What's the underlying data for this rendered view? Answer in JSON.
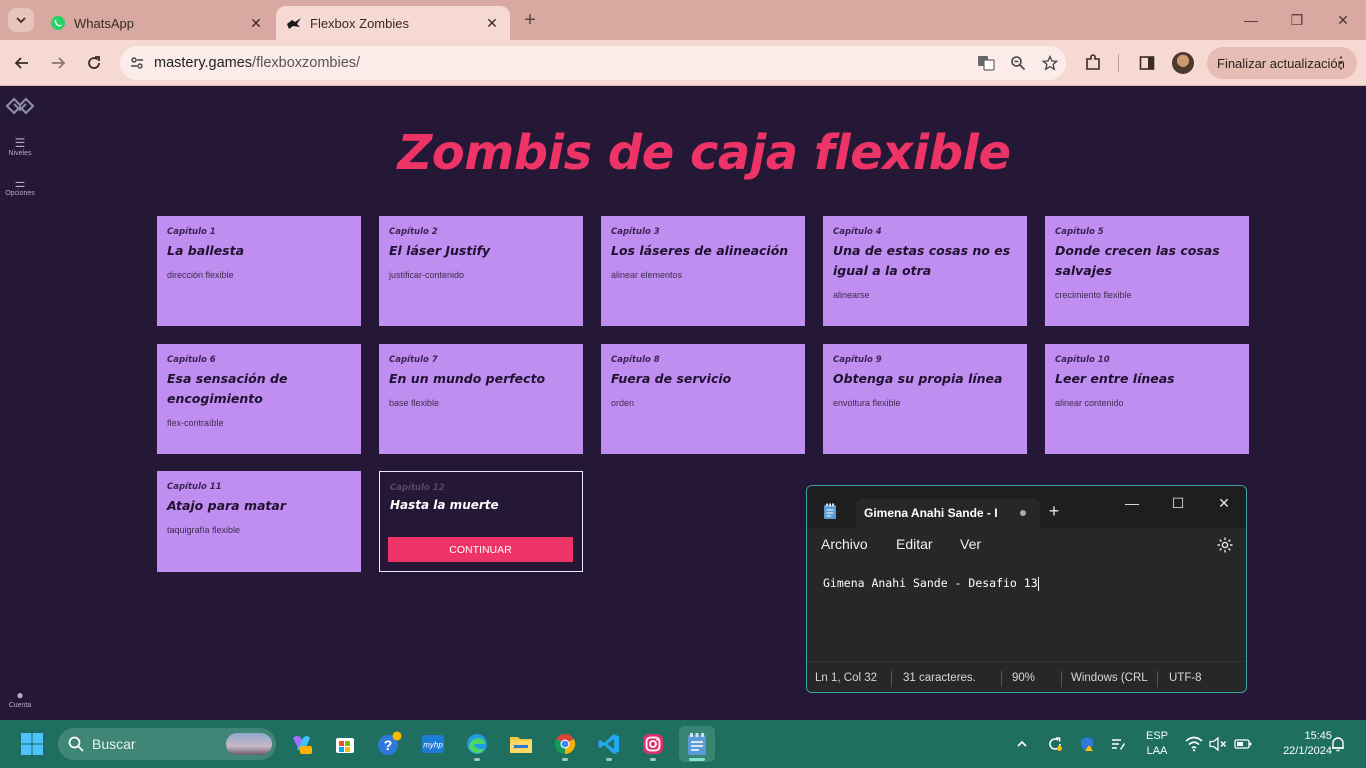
{
  "browser": {
    "tabs": [
      {
        "title": "WhatsApp",
        "icon": "whatsapp-icon",
        "active": false
      },
      {
        "title": "Flexbox Zombies",
        "icon": "flexbox-zombies-icon",
        "active": true
      }
    ],
    "url_host": "mastery.games",
    "url_path": "/flexboxzombies/",
    "update_label": "Finalizar actualización"
  },
  "sidebar": {
    "items": [
      {
        "label": "Niveles",
        "icon": "menu-icon"
      },
      {
        "label": "Opciones",
        "icon": "sliders-icon"
      },
      {
        "label": "Cuenta",
        "icon": "user-icon"
      }
    ]
  },
  "game": {
    "title": "Zombis de caja flexible",
    "chapters": [
      {
        "chapter": "Capítulo 1",
        "name": "La ballesta",
        "concept": "dirección flexible"
      },
      {
        "chapter": "Capítulo 2",
        "name": "El láser Justify",
        "concept": "justificar-contenido"
      },
      {
        "chapter": "Capítulo 3",
        "name": "Los láseres de alineación",
        "concept": "alinear elementos"
      },
      {
        "chapter": "Capítulo 4",
        "name": "Una de estas cosas no es igual a la otra",
        "concept": "alinearse"
      },
      {
        "chapter": "Capítulo 5",
        "name": "Donde crecen las cosas salvajes",
        "concept": "crecimiento flexible"
      },
      {
        "chapter": "Capítulo 6",
        "name": "Esa sensación de encogimiento",
        "concept": "flex-contraíble"
      },
      {
        "chapter": "Capítulo 7",
        "name": "En un mundo perfecto",
        "concept": "base flexible"
      },
      {
        "chapter": "Capítulo 8",
        "name": "Fuera de servicio",
        "concept": "orden"
      },
      {
        "chapter": "Capítulo 9",
        "name": "Obtenga su propia línea",
        "concept": "envoltura flexible"
      },
      {
        "chapter": "Capítulo 10",
        "name": "Leer entre líneas",
        "concept": "alinear contenido"
      },
      {
        "chapter": "Capítulo 11",
        "name": "Atajo para matar",
        "concept": "taquigrafía flexible"
      }
    ],
    "locked_chapter": {
      "chapter": "Capítulo 12",
      "name": "Hasta la muerte",
      "button": "CONTINUAR"
    }
  },
  "notepad": {
    "tab_title": "Gimena Anahi Sande - I",
    "menu": [
      "Archivo",
      "Editar",
      "Ver"
    ],
    "content": "Gimena Anahi Sande - Desafio 13",
    "status": {
      "position": "Ln 1, Col 32",
      "chars": "31 caracteres.",
      "zoom": "90%",
      "line_endings": "Windows (CRL",
      "encoding": "UTF-8"
    }
  },
  "taskbar": {
    "search_label": "Buscar",
    "apps": [
      "copilot-icon",
      "store-icon",
      "help-icon",
      "myhp-icon",
      "edge-icon",
      "file-explorer-icon",
      "chrome-icon",
      "vscode-icon",
      "instagram-icon",
      "notepad-icon"
    ],
    "lang_line1": "ESP",
    "lang_line2": "LAA",
    "time": "15:45",
    "date": "22/1/2024"
  },
  "colors": {
    "page_bg": "#241836",
    "title": "#ee3467",
    "card": "#c08ef0",
    "accent_button": "#ee3467",
    "taskbar": "#1e6f5f"
  }
}
